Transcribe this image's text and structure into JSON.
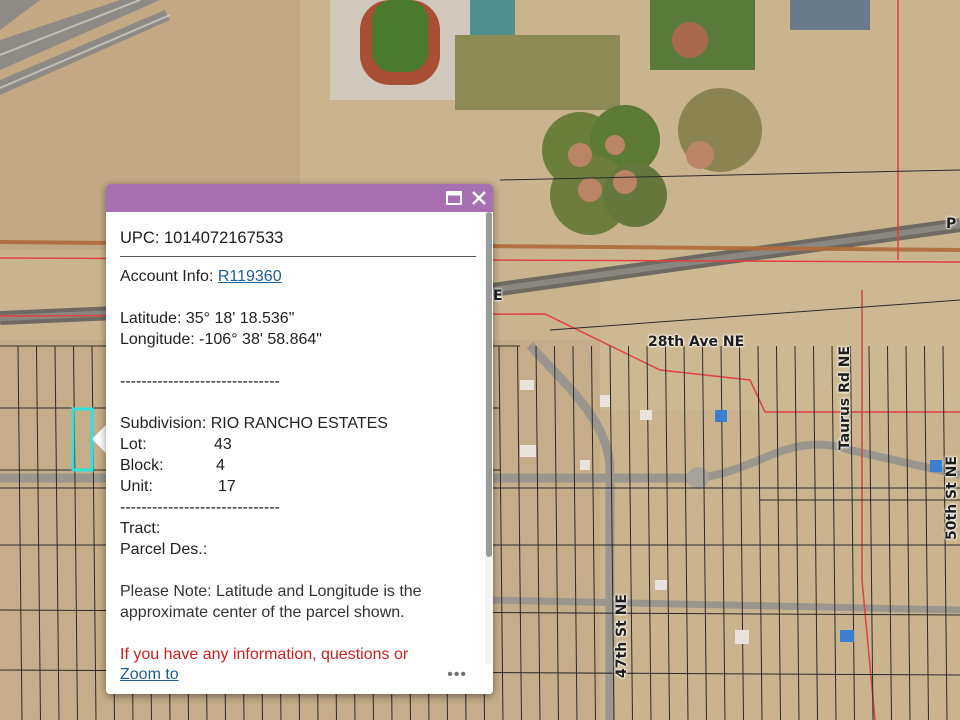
{
  "map": {
    "road_labels": {
      "ave_28th": "28th Ave NE",
      "taurus": "Taurus Rd NE",
      "st_47th": "47th St NE",
      "st_50th": "50th St NE",
      "road_e": "E",
      "road_p": "P"
    }
  },
  "popup": {
    "upc": "UPC: 1014072167533",
    "account_label": "Account Info: ",
    "account_value": "R119360",
    "latitude": "Latitude: 35° 18' 18.536\"",
    "longitude": "Longitude: -106° 38' 58.864\"",
    "separator": "------------------------------",
    "subdivision": "Subdivision: RIO RANCHO ESTATES",
    "lot_label": "Lot:",
    "lot_value": "43",
    "block_label": "Block:",
    "block_value": "4",
    "unit_label": "Unit:",
    "unit_value": "17",
    "tract_label": "Tract:",
    "parcel_des_label": "Parcel Des.:",
    "note": "Please Note: Latitude and Longitude is the approximate center of the parcel shown.",
    "red_note": "If you have any information, questions or concerns about this parcel, please contact",
    "zoom_to": "Zoom to",
    "more": "•••"
  },
  "colors": {
    "header": "#a870b3",
    "link": "#1b5d99",
    "red_text": "#cc1f1f",
    "parcel_highlight": "#2fe0e0",
    "boundary_red": "#e04040"
  }
}
